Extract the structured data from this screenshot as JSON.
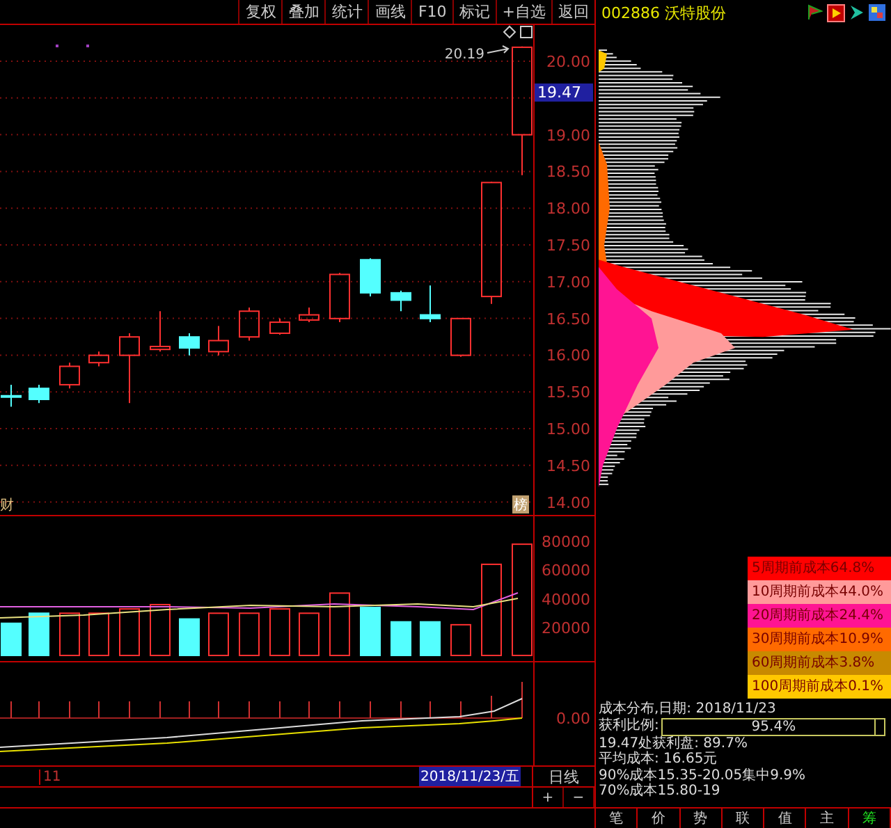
{
  "toolbar": {
    "buttons": [
      "复权",
      "叠加",
      "统计",
      "画线",
      "F10",
      "标记",
      "+自选",
      "返回"
    ]
  },
  "stock": {
    "code": "002886",
    "name": "沃特股份"
  },
  "price_chart": {
    "high_label": "20.19",
    "current_price": "19.47",
    "axis_labels": [
      "20.00",
      "19.00",
      "18.50",
      "18.00",
      "17.50",
      "17.00",
      "16.50",
      "16.00",
      "15.50",
      "15.00",
      "14.50",
      "14.00"
    ],
    "left_marker": "财",
    "right_marker": "榜"
  },
  "volume_chart": {
    "axis_labels": [
      "80000",
      "60000",
      "40000",
      "20000"
    ]
  },
  "indicator_chart": {
    "axis_labels": [
      "0.00"
    ]
  },
  "date_bar": {
    "month_label": "11",
    "current_date": "2018/11/23/五",
    "period": "日线"
  },
  "zoom_buttons": [
    "+",
    "−"
  ],
  "cost_legend": [
    {
      "label": "5周期前成本64.8%",
      "color": "#ff0000"
    },
    {
      "label": "10周期前成本44.0%",
      "color": "#ff9a9a"
    },
    {
      "label": "20周期前成本24.4%",
      "color": "#ff1493"
    },
    {
      "label": "30周期前成本10.9%",
      "color": "#ff6a00"
    },
    {
      "label": "60周期前成本3.8%",
      "color": "#c88a00"
    },
    {
      "label": "100周期前成本0.1%",
      "color": "#ffc800"
    }
  ],
  "cost_info": {
    "title": "成本分布,日期: 2018/11/23",
    "profit_label": "获利比例:",
    "profit_bar": {
      "value": "95.4%",
      "level": 0.954
    },
    "lines": [
      "19.47处获利盘: 89.7%",
      "平均成本: 16.65元",
      "90%成本15.35-20.05集中9.9%",
      "70%成本15.80-19"
    ]
  },
  "bottom_tabs": [
    {
      "label": "笔",
      "selected": false
    },
    {
      "label": "价",
      "selected": false
    },
    {
      "label": "势",
      "selected": false
    },
    {
      "label": "联",
      "selected": false
    },
    {
      "label": "值",
      "selected": false
    },
    {
      "label": "主",
      "selected": false
    },
    {
      "label": "筹",
      "selected": true
    }
  ]
}
